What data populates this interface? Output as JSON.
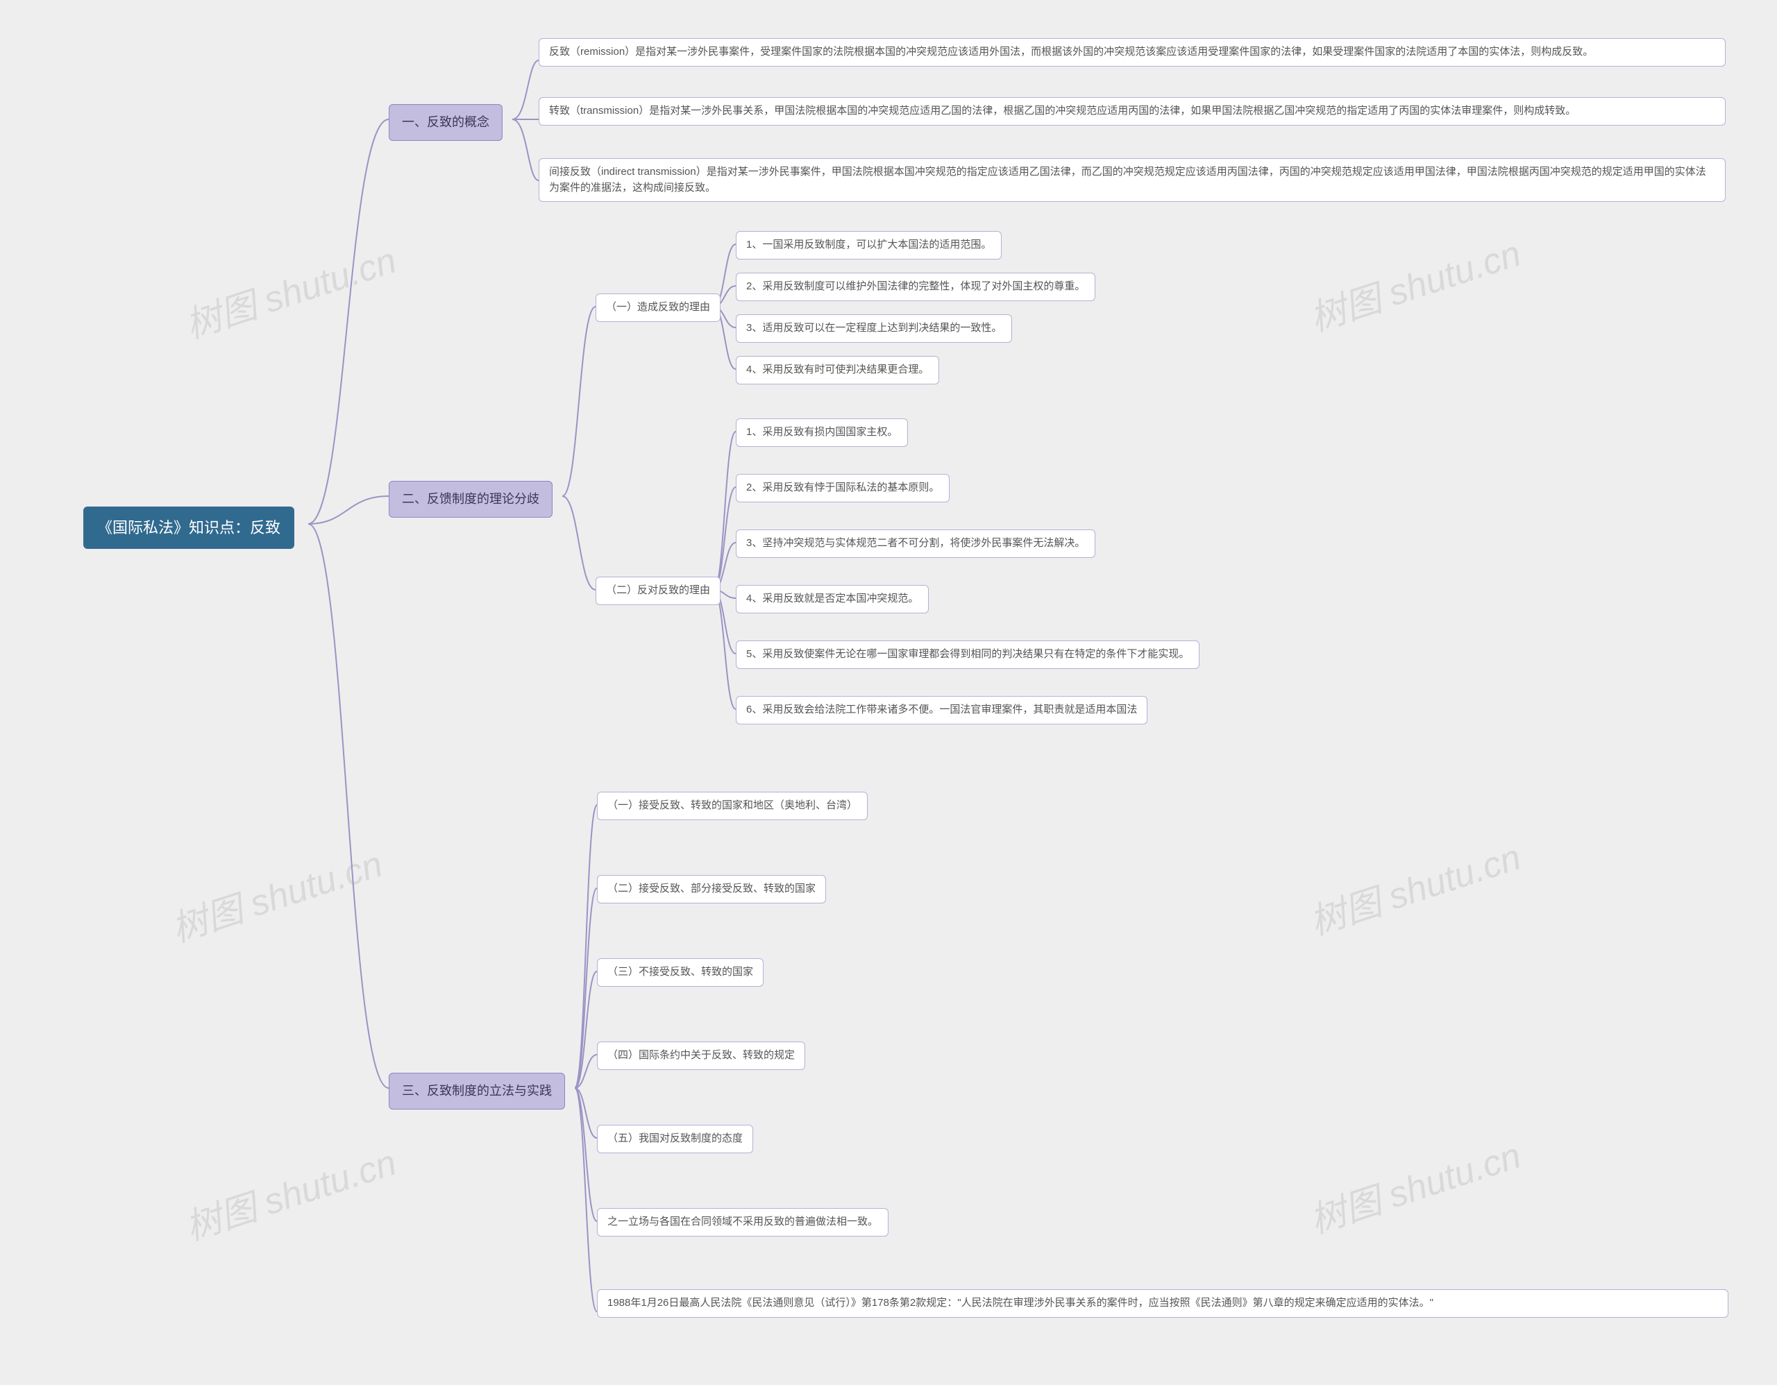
{
  "root": {
    "title": "《国际私法》知识点：反致"
  },
  "branch1": {
    "title": "一、反致的概念",
    "items": [
      "反致（remission）是指对某一涉外民事案件，受理案件国家的法院根据本国的冲突规范应该适用外国法，而根据该外国的冲突规范该案应该适用受理案件国家的法律，如果受理案件国家的法院适用了本国的实体法，则构成反致。",
      "转致（transmission）是指对某一涉外民事关系，甲国法院根据本国的冲突规范应适用乙国的法律，根据乙国的冲突规范应适用丙国的法律，如果甲国法院根据乙国冲突规范的指定适用了丙国的实体法审理案件，则构成转致。",
      "间接反致（indirect transmission）是指对某一涉外民事案件，甲国法院根据本国冲突规范的指定应该适用乙国法律，而乙国的冲突规范规定应该适用丙国法律，丙国的冲突规范规定应该适用甲国法律，甲国法院根据丙国冲突规范的规定适用甲国的实体法为案件的准据法，这构成间接反致。"
    ]
  },
  "branch2": {
    "title": "二、反馈制度的理论分歧",
    "sub1": {
      "title": "（一）造成反致的理由",
      "items": [
        "1、一国采用反致制度，可以扩大本国法的适用范围。",
        "2、采用反致制度可以维护外国法律的完整性，体现了对外国主权的尊重。",
        "3、适用反致可以在一定程度上达到判决结果的一致性。",
        "4、采用反致有时可使判决结果更合理。"
      ]
    },
    "sub2": {
      "title": "（二）反对反致的理由",
      "items": [
        "1、采用反致有损内国国家主权。",
        "2、采用反致有悖于国际私法的基本原则。",
        "3、坚持冲突规范与实体规范二者不可分割，将使涉外民事案件无法解决。",
        "4、采用反致就是否定本国冲突规范。",
        "5、采用反致使案件无论在哪一国家审理都会得到相同的判决结果只有在特定的条件下才能实现。",
        "6、采用反致会给法院工作带来诸多不便。一国法官审理案件，其职责就是适用本国法"
      ]
    }
  },
  "branch3": {
    "title": "三、反致制度的立法与实践",
    "items": [
      "（一）接受反致、转致的国家和地区（奥地利、台湾）",
      "（二）接受反致、部分接受反致、转致的国家",
      "（三）不接受反致、转致的国家",
      "（四）国际条约中关于反致、转致的规定",
      "（五）我国对反致制度的态度",
      "之一立场与各国在合同领域不采用反致的普遍做法相一致。",
      "1988年1月26日最高人民法院《民法通则意见（试行）》第178条第2款规定：\"人民法院在审理涉外民事关系的案件时，应当按照《民法通则》第八章的规定来确定应适用的实体法。\""
    ]
  },
  "watermark": "树图 shutu.cn"
}
